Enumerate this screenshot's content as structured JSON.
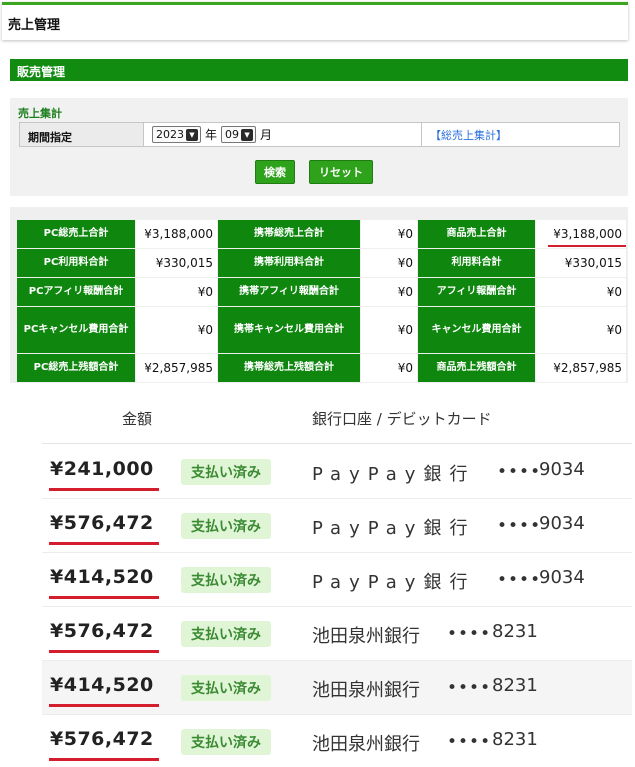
{
  "header": {
    "title": "売上管理"
  },
  "section": {
    "title": "販売管理"
  },
  "filter": {
    "subtitle": "売上集計",
    "period_label": "期間指定",
    "year_value": "2023",
    "year_unit": "年",
    "month_value": "09",
    "month_unit": "月",
    "total_link": "【総売上集計】",
    "search_button": "検索",
    "reset_button": "リセット"
  },
  "totals": {
    "rows": [
      [
        {
          "label": "PC総売上合計",
          "value": "¥3,188,000"
        },
        {
          "label": "携帯総売上合計",
          "value": "¥0"
        },
        {
          "label": "商品売上合計",
          "value": "¥3,188,000"
        }
      ],
      [
        {
          "label": "PC利用料合計",
          "value": "¥330,015"
        },
        {
          "label": "携帯利用料合計",
          "value": "¥0"
        },
        {
          "label": "利用料合計",
          "value": "¥330,015"
        }
      ],
      [
        {
          "label": "PCアフィリ報酬合計",
          "value": "¥0"
        },
        {
          "label": "携帯アフィリ報酬合計",
          "value": "¥0"
        },
        {
          "label": "アフィリ報酬合計",
          "value": "¥0"
        }
      ],
      [
        {
          "label": "PCキャンセル費用合計",
          "value": "¥0"
        },
        {
          "label": "携帯キャンセル費用合計",
          "value": "¥0"
        },
        {
          "label": "キャンセル費用合計",
          "value": "¥0"
        }
      ],
      [
        {
          "label": "PC総売上残額合計",
          "value": "¥2,857,985"
        },
        {
          "label": "携帯総売上残額合計",
          "value": "¥0"
        },
        {
          "label": "商品売上残額合計",
          "value": "¥2,857,985"
        }
      ]
    ]
  },
  "payouts": {
    "header_amount": "金額",
    "header_bank": "銀行口座 / デビットカード",
    "rows": [
      {
        "amount": "¥241,000",
        "status": "支払い済み",
        "bank": "PayPay銀行",
        "masked": "••••",
        "account": "9034"
      },
      {
        "amount": "¥576,472",
        "status": "支払い済み",
        "bank": "PayPay銀行",
        "masked": "••••",
        "account": "9034"
      },
      {
        "amount": "¥414,520",
        "status": "支払い済み",
        "bank": "PayPay銀行",
        "masked": "••••",
        "account": "9034"
      },
      {
        "amount": "¥576,472",
        "status": "支払い済み",
        "bank": "池田泉州銀行",
        "masked": "••••",
        "account": "8231"
      },
      {
        "amount": "¥414,520",
        "status": "支払い済み",
        "bank": "池田泉州銀行",
        "masked": "••••",
        "account": "8231"
      },
      {
        "amount": "¥576,472",
        "status": "支払い済み",
        "bank": "池田泉州銀行",
        "masked": "••••",
        "account": "8231"
      }
    ]
  },
  "colors": {
    "accent_green": "#118c11",
    "highlight_red": "#d41e2d",
    "badge_bg": "#dff5d6"
  }
}
